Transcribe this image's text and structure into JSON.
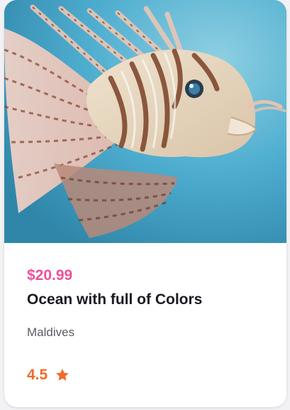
{
  "card": {
    "image_alt": "lionfish-photo",
    "price": "$20.99",
    "title": "Ocean with full of Colors",
    "location": "Maldives",
    "rating": "4.5",
    "rating_icon": "star-icon"
  },
  "colors": {
    "price": "#ee4f9a",
    "title": "#1a1a24",
    "location": "#5b5b64",
    "rating": "#f26a2a"
  }
}
